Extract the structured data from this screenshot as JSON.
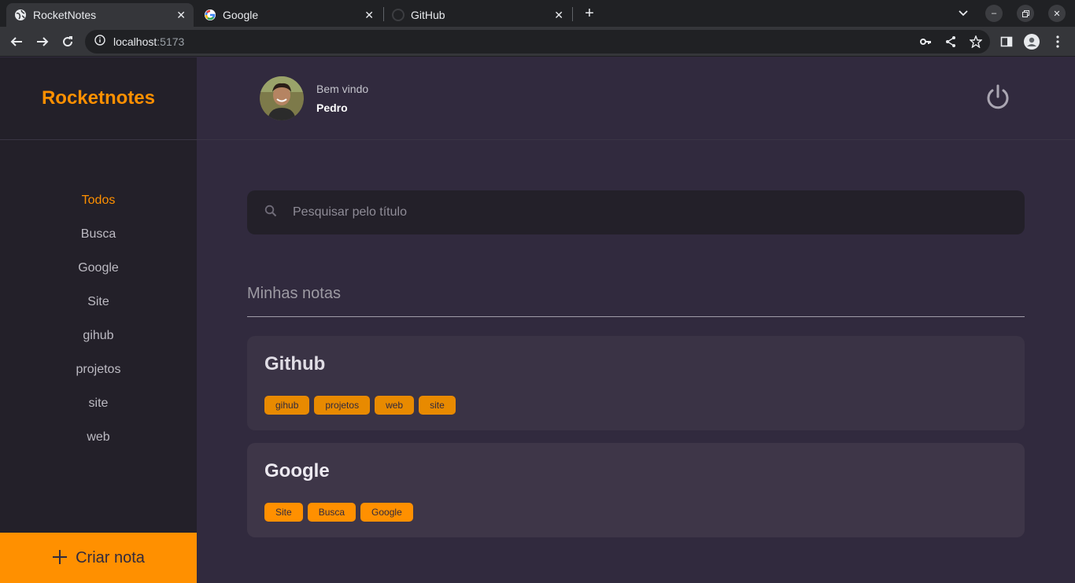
{
  "browser": {
    "tabs": [
      {
        "title": "RocketNotes",
        "icon": "globe-icon",
        "active": true
      },
      {
        "title": "Google",
        "icon": "google-icon",
        "active": false
      },
      {
        "title": "GitHub",
        "icon": "github-icon",
        "active": false
      }
    ],
    "url_host": "localhost",
    "url_port": ":5173"
  },
  "app": {
    "brand": "Rocketnotes",
    "menu": [
      "Todos",
      "Busca",
      "Google",
      "Site",
      "gihub",
      "projetos",
      "site",
      "web"
    ],
    "create_button": "Criar nota",
    "header": {
      "greeting": "Bem vindo",
      "user_name": "Pedro"
    },
    "search_placeholder": "Pesquisar pelo título",
    "section_title": "Minhas notas",
    "notes": [
      {
        "title": "Github",
        "tags": [
          "gihub",
          "projetos",
          "web",
          "site"
        ]
      },
      {
        "title": "Google",
        "tags": [
          "Site",
          "Busca",
          "Google"
        ]
      }
    ],
    "colors": {
      "accent": "#ff9000",
      "background": "#312a3e",
      "sidebar": "#232029",
      "card": "#3e3648"
    }
  }
}
